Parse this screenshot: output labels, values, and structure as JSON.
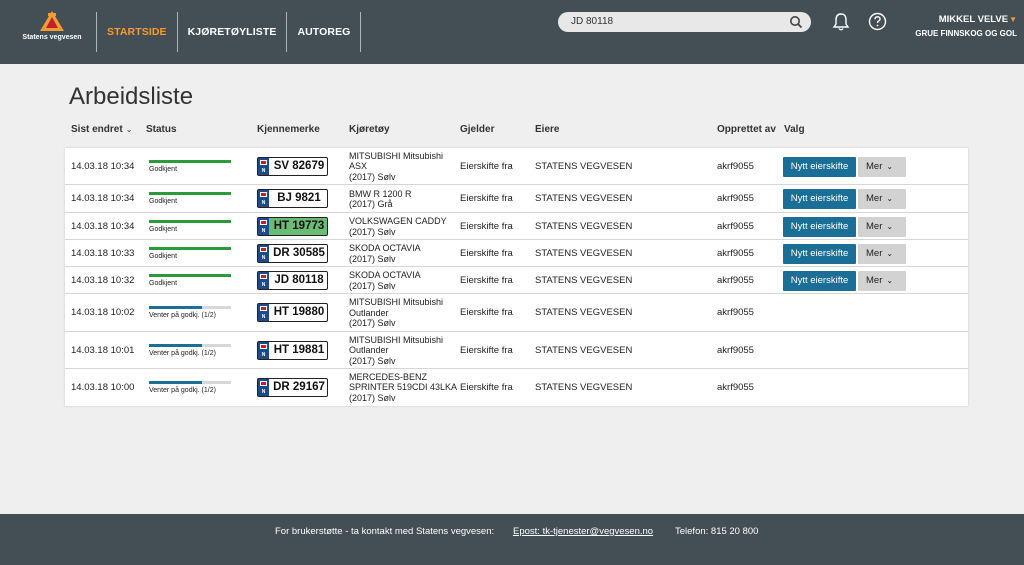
{
  "brand": {
    "name": "Statens vegvesen"
  },
  "nav": [
    {
      "label": "STARTSIDE",
      "active": true
    },
    {
      "label": "KJØRETØYLISTE",
      "active": false
    },
    {
      "label": "AUTOREG",
      "active": false
    }
  ],
  "search": {
    "value": "JD 80118"
  },
  "user": {
    "name": "MIKKEL VELVE",
    "org": "GRUE FINNSKOG OG GOL"
  },
  "page": {
    "title": "Arbeidsliste"
  },
  "columns": {
    "changed": "Sist endret",
    "status": "Status",
    "plate": "Kjennemerke",
    "vehicle": "Kjøretøy",
    "applies": "Gjelder",
    "owners": "Eiere",
    "created_by": "Opprettet av",
    "choice": "Valg"
  },
  "rows": [
    {
      "date": "14.03.18 10:34",
      "status": "Godkjent",
      "status_level": 1.0,
      "status_color": "#2a9a3a",
      "plate": "SV 82679",
      "plate_green": false,
      "vehicle": [
        "MITSUBISHI Mitsubishi",
        "ASX",
        "(2017) Sølv"
      ],
      "applies": "Eierskifte fra",
      "owner": "STATENS VEGVESEN",
      "created_by": "akrf9055",
      "action": "Nytt eierskifte",
      "more": "Mer"
    },
    {
      "date": "14.03.18 10:34",
      "status": "Godkjent",
      "status_level": 1.0,
      "status_color": "#2a9a3a",
      "plate": "BJ 9821",
      "plate_green": false,
      "vehicle": [
        "BMW R 1200 R",
        "(2017) Grå"
      ],
      "applies": "Eierskifte fra",
      "owner": "STATENS VEGVESEN",
      "created_by": "akrf9055",
      "action": "Nytt eierskifte",
      "more": "Mer"
    },
    {
      "date": "14.03.18 10:34",
      "status": "Godkjent",
      "status_level": 1.0,
      "status_color": "#2a9a3a",
      "plate": "HT 19773",
      "plate_green": true,
      "vehicle": [
        "VOLKSWAGEN CADDY",
        "(2017) Sølv"
      ],
      "applies": "Eierskifte fra",
      "owner": "STATENS VEGVESEN",
      "created_by": "akrf9055",
      "action": "Nytt eierskifte",
      "more": "Mer"
    },
    {
      "date": "14.03.18 10:33",
      "status": "Godkjent",
      "status_level": 1.0,
      "status_color": "#2a9a3a",
      "plate": "DR 30585",
      "plate_green": false,
      "vehicle": [
        "SKODA OCTAVIA",
        "(2017) Sølv"
      ],
      "applies": "Eierskifte fra",
      "owner": "STATENS VEGVESEN",
      "created_by": "akrf9055",
      "action": "Nytt eierskifte",
      "more": "Mer"
    },
    {
      "date": "14.03.18 10:32",
      "status": "Godkjent",
      "status_level": 1.0,
      "status_color": "#2a9a3a",
      "plate": "JD 80118",
      "plate_green": false,
      "vehicle": [
        "SKODA OCTAVIA",
        "(2017) Sølv"
      ],
      "applies": "Eierskifte fra",
      "owner": "STATENS VEGVESEN",
      "created_by": "akrf9055",
      "action": "Nytt eierskifte",
      "more": "Mer"
    },
    {
      "date": "14.03.18 10:02",
      "status": "Venter på godkj. (1/2)",
      "status_level": 0.65,
      "status_color": "#1b6e96",
      "plate": "HT 19880",
      "plate_green": false,
      "vehicle": [
        "MITSUBISHI Mitsubishi",
        "Outlander",
        "(2017) Sølv"
      ],
      "applies": "Eierskifte fra",
      "owner": "STATENS VEGVESEN",
      "created_by": "akrf9055",
      "action": "",
      "more": ""
    },
    {
      "date": "14.03.18 10:01",
      "status": "Venter på godkj. (1/2)",
      "status_level": 0.65,
      "status_color": "#1b6e96",
      "plate": "HT 19881",
      "plate_green": false,
      "vehicle": [
        "MITSUBISHI Mitsubishi",
        "Outlander",
        "(2017) Sølv"
      ],
      "applies": "Eierskifte fra",
      "owner": "STATENS VEGVESEN",
      "created_by": "akrf9055",
      "action": "",
      "more": ""
    },
    {
      "date": "14.03.18 10:00",
      "status": "Venter på godkj. (1/2)",
      "status_level": 0.65,
      "status_color": "#1b6e96",
      "plate": "DR 29167",
      "plate_green": false,
      "vehicle": [
        "MERCEDES-BENZ",
        "SPRINTER 519CDI 43LKA",
        "(2017) Sølv"
      ],
      "applies": "Eierskifte fra",
      "owner": "STATENS VEGVESEN",
      "created_by": "akrf9055",
      "action": "",
      "more": ""
    }
  ],
  "footer": {
    "support": "For brukerstøtte - ta kontakt med Statens vegvesen:",
    "email": "Epost: tk-tjenester@vegvesen.no",
    "phone": "Telefon: 815 20 800"
  }
}
